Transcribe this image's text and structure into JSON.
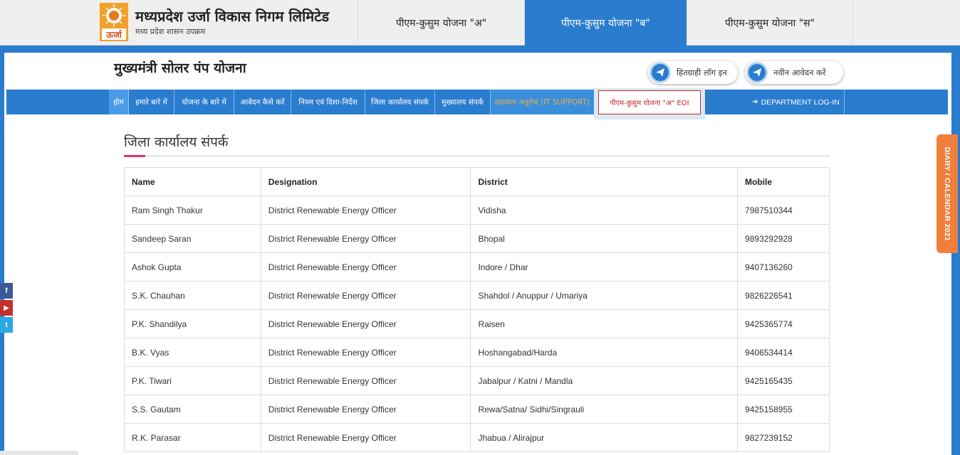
{
  "header": {
    "org_title": "मध्यप्रदेश उर्जा विकास निगम लिमिटेड",
    "org_subtitle": "मध्य प्रदेश शासन उपक्रम",
    "logo_text": "ऊर्जा",
    "scheme_tabs": [
      {
        "label": "पीएम-कुसुम योजना \"अ\"",
        "active": false
      },
      {
        "label": "पीएम-कुसुम योजना \"ब\"",
        "active": true
      },
      {
        "label": "पीएम-कुसुम योजना \"स\"",
        "active": false
      }
    ]
  },
  "site": {
    "title": "मुख्यमंत्री सोलर पंप योजना",
    "actions": {
      "beneficiary_login": "हितग्राही लॉग इन",
      "new_application": "नवीन आवेदन करें"
    }
  },
  "nav": {
    "items": [
      {
        "label": "होम"
      },
      {
        "label": "हमारे बारे में"
      },
      {
        "label": "योजना के बारे में"
      },
      {
        "label": "आवेदन कैसे करें"
      },
      {
        "label": "नियम एवं दिशा-निर्देश"
      },
      {
        "label": "जिला कार्यालय संपर्क"
      },
      {
        "label": "मुख्यालय संपर्क"
      },
      {
        "label": "सहायता अनुरोध (IT SUPPORT)"
      }
    ],
    "eoi": "पीएम-कुसुम योजना \"अ\" EOI",
    "department_login": "DEPARTMENT LOG-IN"
  },
  "section": {
    "title": "जिला कार्यालय संपर्क"
  },
  "table": {
    "headers": [
      "Name",
      "Designation",
      "District",
      "Mobile"
    ],
    "rows": [
      [
        "Ram Singh Thakur",
        "District Renewable Energy Officer",
        "Vidisha",
        "7987510344"
      ],
      [
        "Sandeep Saran",
        "District Renewable Energy Officer",
        "Bhopal",
        "9893292928"
      ],
      [
        "Ashok Gupta",
        "District Renewable Energy Officer",
        "Indore / Dhar",
        "9407136260"
      ],
      [
        "S.K. Chauhan",
        "District Renewable Energy Officer",
        "Shahdol / Anuppur / Umariya",
        "9826226541"
      ],
      [
        "P.K. Shandilya",
        "District Renewable Energy Officer",
        "Raisen",
        "9425365774"
      ],
      [
        "B.K. Vyas",
        "District Renewable Energy Officer",
        "Hoshangabad/Harda",
        "9406534414"
      ],
      [
        "P.K. Tiwari",
        "District Renewable Energy Officer",
        "Jabalpur / Katni / Mandla",
        "9425165435"
      ],
      [
        "S.S. Gautam",
        "District Renewable Energy Officer",
        "Rewa/Satna/ Sidhi/Singrauli",
        "9425158955"
      ],
      [
        "R.K. Parasar",
        "District Renewable Energy Officer",
        "Jhabua / Alirajpur",
        "9827239152"
      ]
    ]
  },
  "side_tab": {
    "label": "DIARY / CALENDAR 2021"
  },
  "social": {
    "facebook": "f",
    "youtube": "▶",
    "twitter": "t"
  },
  "colors": {
    "primary_blue": "#2a7ccf",
    "accent_pink": "#e2336f",
    "diary_orange": "#f07f3c",
    "eoi_red": "#c62828"
  }
}
